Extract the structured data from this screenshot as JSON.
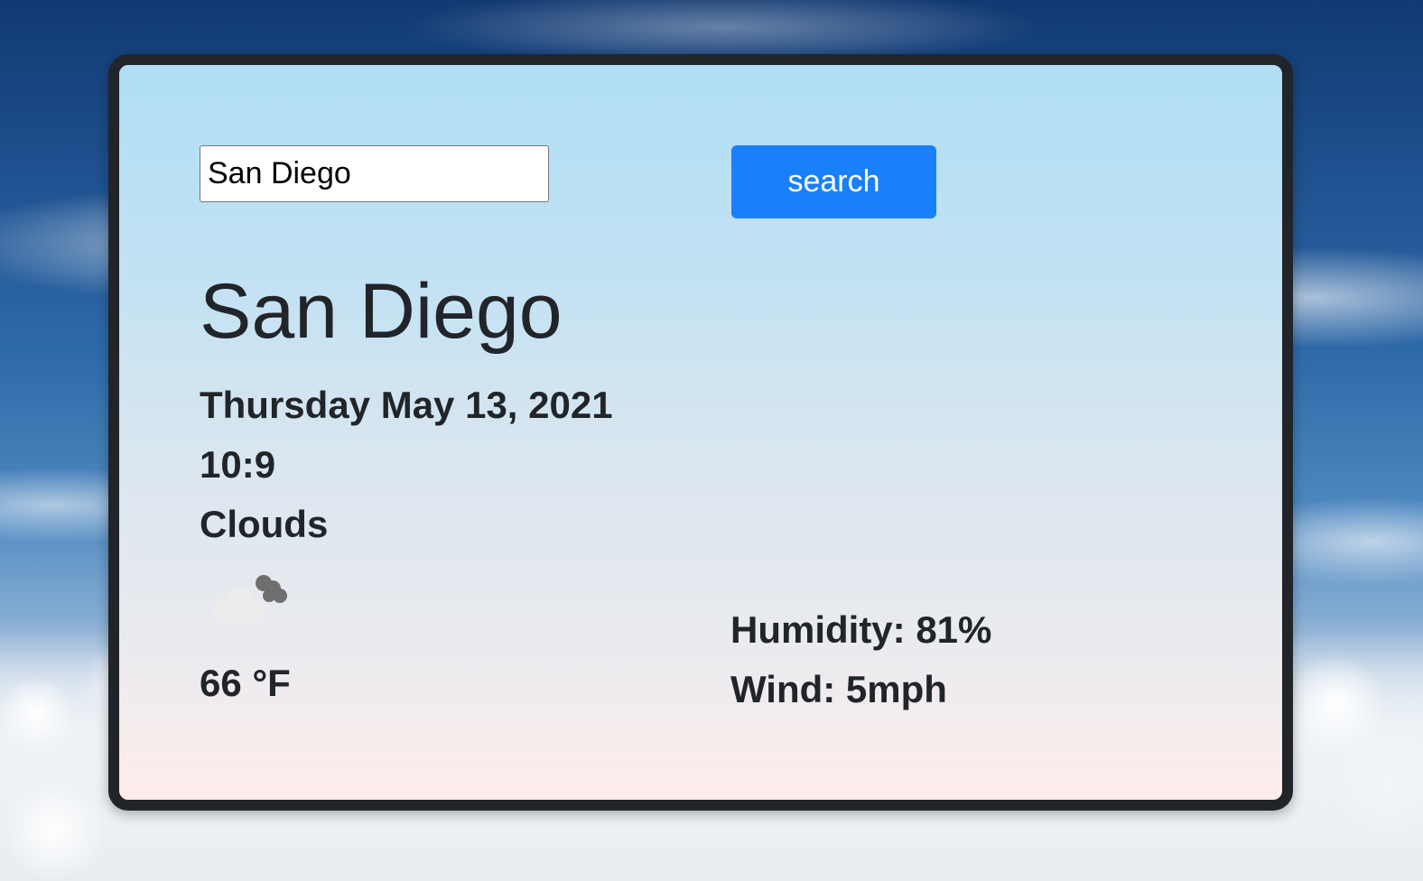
{
  "search": {
    "value": "San Diego",
    "button_label": "search"
  },
  "weather": {
    "city": "San Diego",
    "date": "Thursday May 13, 2021",
    "time": "10:9",
    "condition": "Clouds",
    "icon": "broken-clouds-icon",
    "temperature": "66 °F",
    "humidity": "Humidity: 81%",
    "wind": "Wind: 5mph"
  },
  "colors": {
    "accent": "#1a7ffb",
    "text": "#212529",
    "border": "#212529"
  }
}
